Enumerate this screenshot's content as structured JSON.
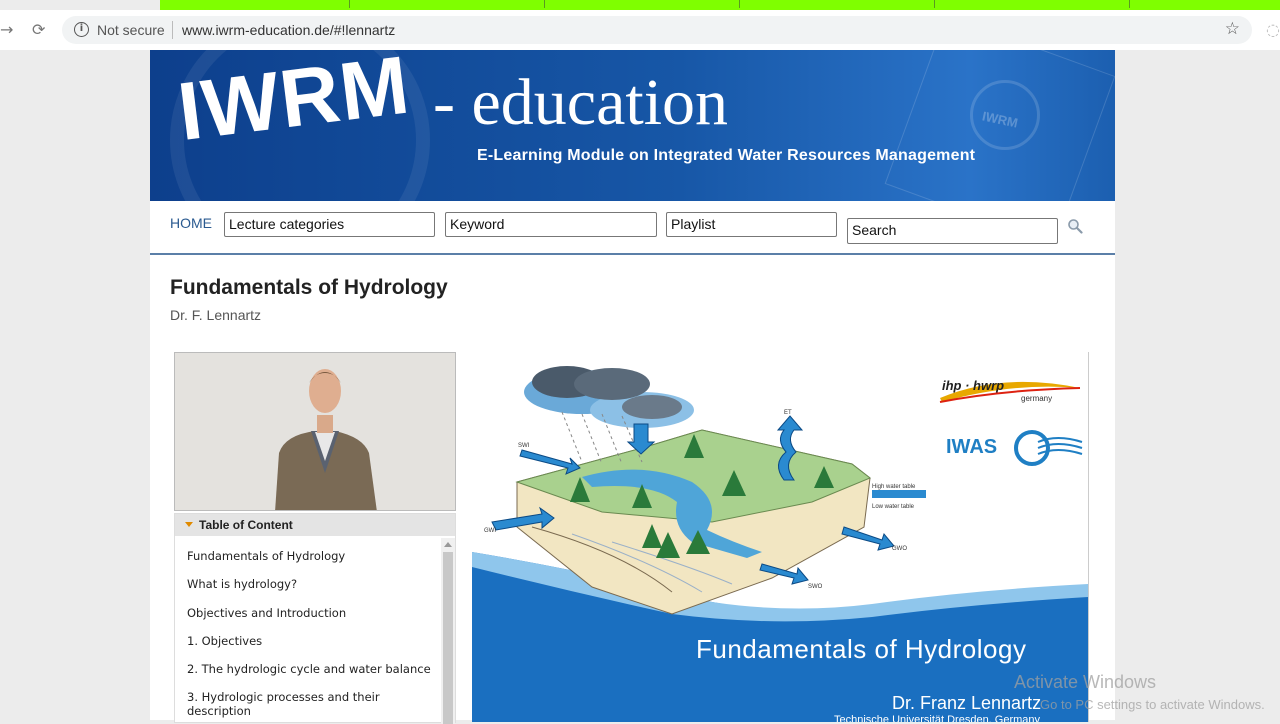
{
  "browser": {
    "security_label": "Not secure",
    "url": "www.iwrm-education.de/#!lennartz"
  },
  "banner": {
    "logo_main": "IWRM",
    "logo_suffix": "- education",
    "tagline": "E-Learning Module on Integrated Water Resources Management",
    "watermark": "IWRM"
  },
  "nav": {
    "home": "HOME",
    "lecture_categories": "Lecture categories",
    "keyword": "Keyword",
    "playlist": "Playlist",
    "search_value": "Search"
  },
  "lecture": {
    "title": "Fundamentals of Hydrology",
    "author": "Dr. F. Lennartz"
  },
  "toc": {
    "heading": "Table of Content",
    "items": [
      "Fundamentals of Hydrology",
      "What is hydrology?",
      "Objectives and Introduction",
      "1. Objectives",
      "2. The hydrologic cycle and water balance",
      "3. Hydrologic processes and their description"
    ]
  },
  "slide": {
    "title": "Fundamentals of Hydrology",
    "author": "Dr. Franz Lennartz",
    "institution": "Technische Universität Dresden, Germany",
    "logo_ihp": "ihp · hwrp",
    "logo_ihp_sub": "germany",
    "logo_iwas": "IWAS",
    "diagram_labels": {
      "swi": "SWI",
      "et": "ET",
      "gwi": "GWI",
      "gwo": "GWO",
      "swo": "SWO",
      "high_water_table": "High water table",
      "low_water_table": "Low water table"
    }
  },
  "overlay": {
    "activate_title": "Activate Windows",
    "activate_hint": "Go to PC settings to activate Windows."
  },
  "colors": {
    "banner_blue": "#1757a7",
    "nav_link": "#2a5a90",
    "slide_blue": "#1a6fc0",
    "toc_arrow": "#e08a00"
  }
}
